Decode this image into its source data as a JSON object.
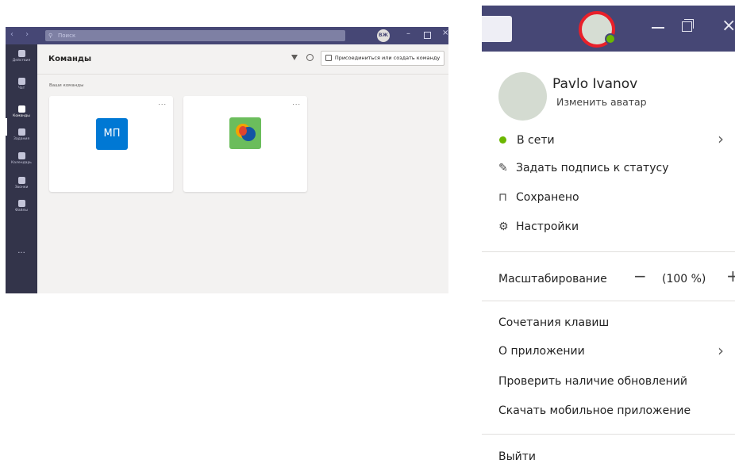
{
  "teams_window": {
    "search_placeholder": "Поиск",
    "top_avatar_initials": "ВЖ",
    "rail": [
      {
        "label": "Действия",
        "icon": "bell-icon"
      },
      {
        "label": "Чат",
        "icon": "chat-icon"
      },
      {
        "label": "Команды",
        "icon": "teams-icon",
        "active": true
      },
      {
        "label": "Задания",
        "icon": "assignments-icon"
      },
      {
        "label": "Календарь",
        "icon": "calendar-icon"
      },
      {
        "label": "Звонки",
        "icon": "phone-icon"
      },
      {
        "label": "Файлы",
        "icon": "files-icon"
      }
    ],
    "rail_more": "...",
    "title": "Команды",
    "join_button": "Присоединиться или создать команду",
    "section_label": "Ваши команды",
    "cards": [
      {
        "avatar_text": "МП",
        "more": "..."
      },
      {
        "avatar_text": "",
        "more": "..."
      }
    ]
  },
  "profile_panel": {
    "user_name": "Pavlo Ivanov",
    "change_avatar": "Изменить аватар",
    "status": "В сети",
    "set_status_message": "Задать подпись к статусу",
    "saved": "Сохранено",
    "settings": "Настройки",
    "zoom_label": "Масштабирование",
    "zoom_minus": "−",
    "zoom_value": "(100 %)",
    "zoom_plus": "+",
    "keyboard_shortcuts": "Сочетания клавиш",
    "about": "О приложении",
    "check_updates": "Проверить наличие обновлений",
    "download_mobile": "Скачать мобильное приложение",
    "sign_out": "Выйти",
    "accent_color": "#464775",
    "status_color": "#6bb700"
  }
}
